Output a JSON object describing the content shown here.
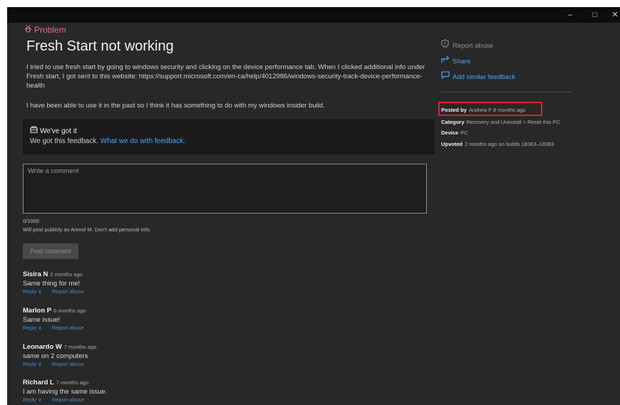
{
  "window": {
    "minimize_glyph": "–",
    "maximize_glyph": "□",
    "close_glyph": "✕"
  },
  "problem": {
    "type_label": "Problem",
    "type_icon": "bug-icon",
    "title": "Fresh Start not working",
    "description": "I tried to use fresh start by going to windows security and clicking on the device performance tab. When I clicked additional info under Fresh start, I got sent to this website: https://support.microsoft.com/en-ca/help/4012986/windows-security-track-device-performance-health",
    "description2": "I have been able to use it in the past so I think it has something to do with my windows insider build."
  },
  "status": {
    "heading": "We've got it",
    "text": "We got this feedback.",
    "link": "What we do with feedback."
  },
  "comment_form": {
    "placeholder": "Write a comment",
    "counter": "0/1000",
    "note": "Will post publicly as Anmol M. Don't add personal info.",
    "post_button": "Post comment"
  },
  "comments": [
    {
      "author": "Sisira N",
      "time": "2 months ago",
      "text": "Same thing for me!",
      "reply": "Reply ∨",
      "report": "Report abuse"
    },
    {
      "author": "Marlon P",
      "time": "6 months ago",
      "text": "Same issue!",
      "reply": "Reply ∨",
      "report": "Report abuse"
    },
    {
      "author": "Leonardo W",
      "time": "7 months ago",
      "text": "same on 2 computers",
      "reply": "Reply ∨",
      "report": "Report abuse"
    },
    {
      "author": "Richard L",
      "time": "7 months ago",
      "text": "I am having the same issue.",
      "reply": "Reply ∨",
      "report": "Report abuse"
    }
  ],
  "sidebar": {
    "report_abuse": "Report abuse",
    "share": "Share",
    "add_similar": "Add similar feedback",
    "posted_by_label": "Posted by",
    "posted_by_value": "Andrew F 8 months ago",
    "category_label": "Category",
    "category_value": "Recovery and Uninstall > Reset this PC",
    "device_label": "Device",
    "device_value": "PC",
    "upvoted_label": "Upvoted",
    "upvoted_value": "2 months ago on builds 18363–18363"
  },
  "colors": {
    "background": "#282828",
    "accent_link": "#4aa3f0",
    "problem_pink": "#e66a8c",
    "highlight_red": "#e01e2e"
  }
}
